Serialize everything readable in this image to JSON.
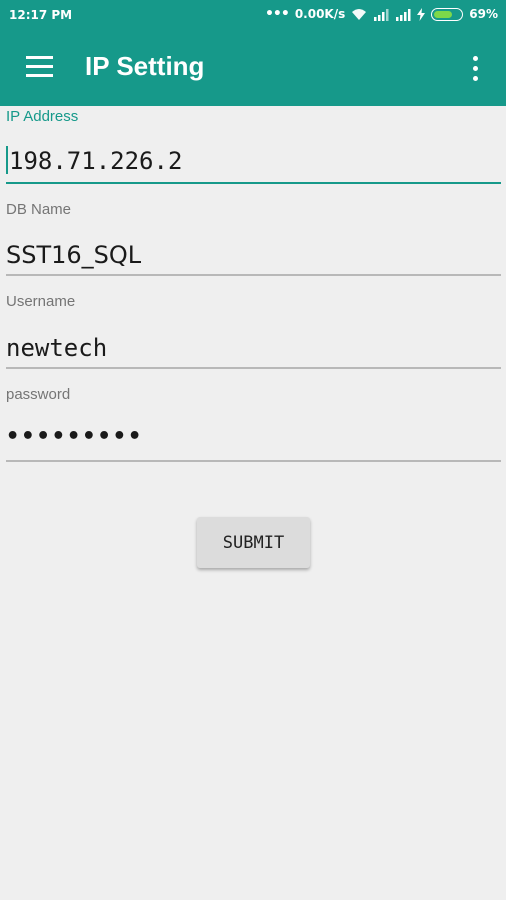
{
  "status_bar": {
    "time": "12:17 PM",
    "more_dots": "•••",
    "network_speed": "0.00K/s",
    "battery_percent": "69%",
    "battery_level": 0.69,
    "icons": [
      "wifi-icon",
      "signal-icon",
      "signal-icon",
      "charging-bolt-icon",
      "battery-icon"
    ]
  },
  "toolbar": {
    "title": "IP Setting",
    "menu_icon": "hamburger-menu-icon",
    "overflow_icon": "more-vert-icon"
  },
  "form": {
    "ip_address": {
      "label": "IP Address",
      "value": "198.71.226.2"
    },
    "db_name": {
      "label": "DB Name",
      "value": "SST16_SQL"
    },
    "username": {
      "label": "Username",
      "value": "newtech"
    },
    "password": {
      "label": "password",
      "value": "•••••••••"
    }
  },
  "submit_label": "SUBMIT",
  "colors": {
    "primary": "#16998a",
    "background": "#efefef",
    "accent": "#16998a",
    "battery_fill": "#7dd84a"
  }
}
